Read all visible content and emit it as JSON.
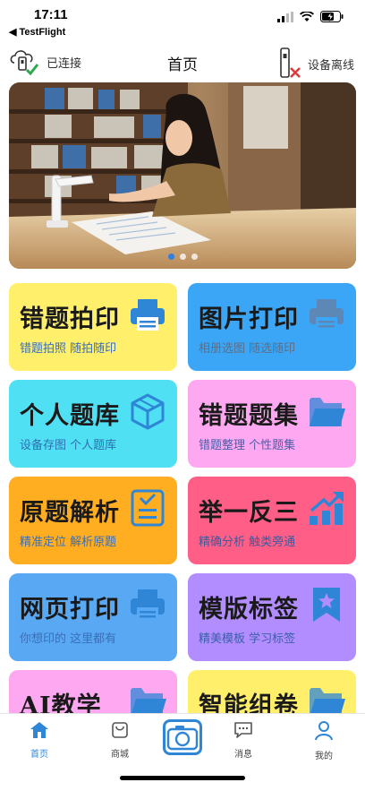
{
  "status_bar": {
    "time": "17:11",
    "back_app": "◀ TestFlight"
  },
  "nav": {
    "left_label": "已连接",
    "title": "首页",
    "right_label": "设备离线"
  },
  "banner": {
    "page_count": 3,
    "active_page": 1
  },
  "cards": [
    {
      "title": "错题拍印",
      "subtitle": "错题拍照 随拍随印",
      "bg": "#ffef6b",
      "sub_color": "#3a6fb8",
      "icon": "printer-icon",
      "icon_color": "#2f86d6"
    },
    {
      "title": "图片打印",
      "subtitle": "相册选图 随选随印",
      "bg": "#3aa6f5",
      "sub_color": "#5b6f8a",
      "icon": "printer-icon",
      "icon_color": "#5d87b5"
    },
    {
      "title": "个人题库",
      "subtitle": "设备存图 个人题库",
      "bg": "#4fe0f4",
      "sub_color": "#2f6fb0",
      "icon": "cube-icon",
      "icon_color": "#2f86d6"
    },
    {
      "title": "错题题集",
      "subtitle": "错题整理 个性题集",
      "bg": "#fda8f1",
      "sub_color": "#4a5fa8",
      "icon": "folder-icon",
      "icon_color": "#2f86d6"
    },
    {
      "title": "原题解析",
      "subtitle": "精准定位 解析原题",
      "bg": "#ffad21",
      "sub_color": "#3a6fb8",
      "icon": "checklist-icon",
      "icon_color": "#2f86d6"
    },
    {
      "title": "举一反三",
      "subtitle": "精确分析 触类旁通",
      "bg": "#ff5f87",
      "sub_color": "#3c5a9e",
      "icon": "growth-chart-icon",
      "icon_color": "#2f86d6"
    },
    {
      "title": "网页打印",
      "subtitle": "你想印的 这里都有",
      "bg": "#58a8f4",
      "sub_color": "#3a6fb8",
      "icon": "printer-icon",
      "icon_color": "#2f86d6"
    },
    {
      "title": "模版标签",
      "subtitle": "精美模板 学习标签",
      "bg": "#b28dff",
      "sub_color": "#3a5fa8",
      "icon": "bookmark-icon",
      "icon_color": "#2f86d6"
    },
    {
      "title": "AI教学",
      "subtitle": "",
      "bg": "#fda8f1",
      "sub_color": "#3a6fb8",
      "icon": "folder-icon",
      "icon_color": "#2f86d6"
    },
    {
      "title": "智能组卷",
      "subtitle": "",
      "bg": "#ffef6b",
      "sub_color": "#3a6fb8",
      "icon": "folder-icon",
      "icon_color": "#2f86d6"
    }
  ],
  "tabbar": {
    "home": "首页",
    "mall": "商城",
    "messages": "消息",
    "profile": "我的",
    "active_color": "#2f86d6"
  }
}
